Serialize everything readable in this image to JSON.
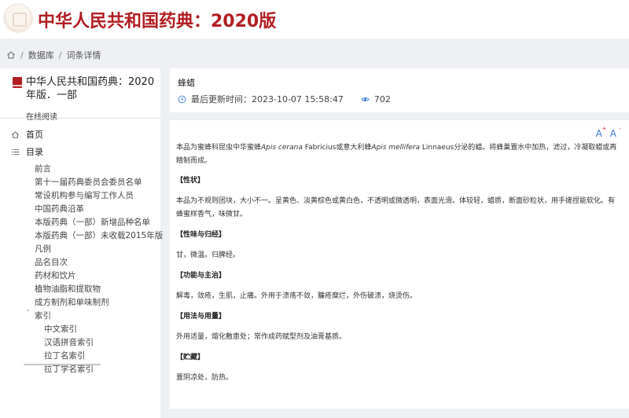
{
  "header": {
    "site_title": "中华人民共和国药典：2020版"
  },
  "breadcrumb": {
    "items": [
      "数据库",
      "词条详情"
    ]
  },
  "sidebar": {
    "book_title": "中华人民共和国药典：2020年版．一部",
    "read_online": "在线阅读",
    "nav_home": "首页",
    "nav_toc": "目录",
    "toc_items": [
      "前言",
      "第十一届药典委员会委员名单",
      "常设机构参与编写工作人员",
      "中国药典沿革",
      "本版药典（一部）新增品种名单",
      "本版药典（一部）未收载2015年版",
      "凡例",
      "品名目次",
      "药材和饮片",
      "植物油脂和提取物",
      "成方制剂和单味制剂"
    ],
    "index_label": "索引",
    "index_sub": [
      "中文索引",
      "汉语拼音索引",
      "拉丁名索引",
      "拉丁学名索引"
    ]
  },
  "entry": {
    "name": "蜂蜡",
    "updated_label": "最后更新时间：",
    "updated_value": "2023-10-07 15:58:47",
    "views": "702"
  },
  "font_tools": {
    "increase": "A",
    "decrease": "A",
    "plus": "+",
    "minus": "-"
  },
  "content": {
    "intro_1": "本品为蜜蜂科昆虫中华蜜蜂",
    "intro_sp1": "Apis cerana",
    "intro_2": " Fabricius或意大利蜂",
    "intro_sp2": "Apis mellifera",
    "intro_3": " Linnaeus分泌的蜡。将蜂巢置水中加热，滤过，冷凝取蜡或再精制而成。",
    "sec_xingzhuang": "【性状】",
    "xingzhuang": "本品为不规则团块，大小不一。呈黄色、淡黄棕色或黄白色，不透明或微透明，表面光滑。体较轻，蜡质，断面砂粒状，用手搓捏能软化。有蜂蜜样香气，味微甘。",
    "sec_xingwei": "【性味与归经】",
    "xingwei": "甘，微温。归脾经。",
    "sec_gongneng": "【功能与主治】",
    "gongneng": "解毒，敛疮，生肌，止痛。外用于溃疡不敛，臁疮糜烂，外伤破溃，烧烫伤。",
    "sec_yongfa": "【用法与用量】",
    "yongfa": "外用适量，熔化敷患处；常作成药赋型剂及油膏基质。",
    "sec_zhucang": "【贮藏】",
    "zhucang": "置阴凉处，防热。"
  }
}
